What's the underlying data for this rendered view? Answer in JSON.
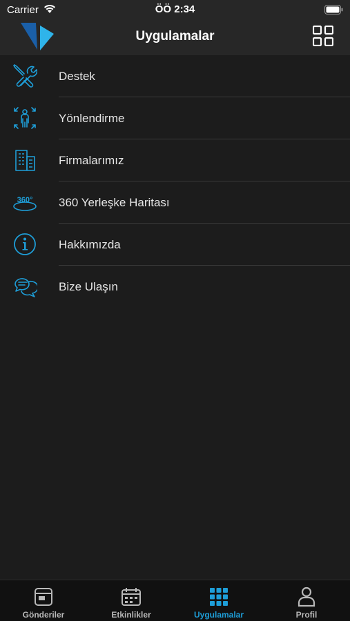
{
  "status_bar": {
    "carrier": "Carrier",
    "time": "ÖÖ 2:34"
  },
  "header": {
    "title": "Uygulamalar",
    "logo": "app-logo",
    "action_icon": "grid-icon"
  },
  "menu": {
    "items": [
      {
        "label": "Destek",
        "icon": "tools-icon"
      },
      {
        "label": "Yönlendirme",
        "icon": "direction-person-icon"
      },
      {
        "label": "Firmalarımız",
        "icon": "building-icon"
      },
      {
        "label": "360 Yerleşke Haritası",
        "icon": "360-view-icon",
        "icon_text": "360°"
      },
      {
        "label": "Hakkımızda",
        "icon": "info-icon"
      },
      {
        "label": "Bize Ulaşın",
        "icon": "chat-bubbles-icon"
      }
    ]
  },
  "tab_bar": {
    "active": "Uygulamalar",
    "tabs": [
      {
        "label": "Gönderiler",
        "icon": "posts-icon"
      },
      {
        "label": "Etkinlikler",
        "icon": "calendar-icon"
      },
      {
        "label": "Uygulamalar",
        "icon": "apps-grid-icon"
      },
      {
        "label": "Profil",
        "icon": "profile-icon"
      }
    ]
  },
  "colors": {
    "accent": "#1e9ed8",
    "background": "#1c1c1c",
    "bar": "#272727",
    "tab_bar": "#111111"
  }
}
